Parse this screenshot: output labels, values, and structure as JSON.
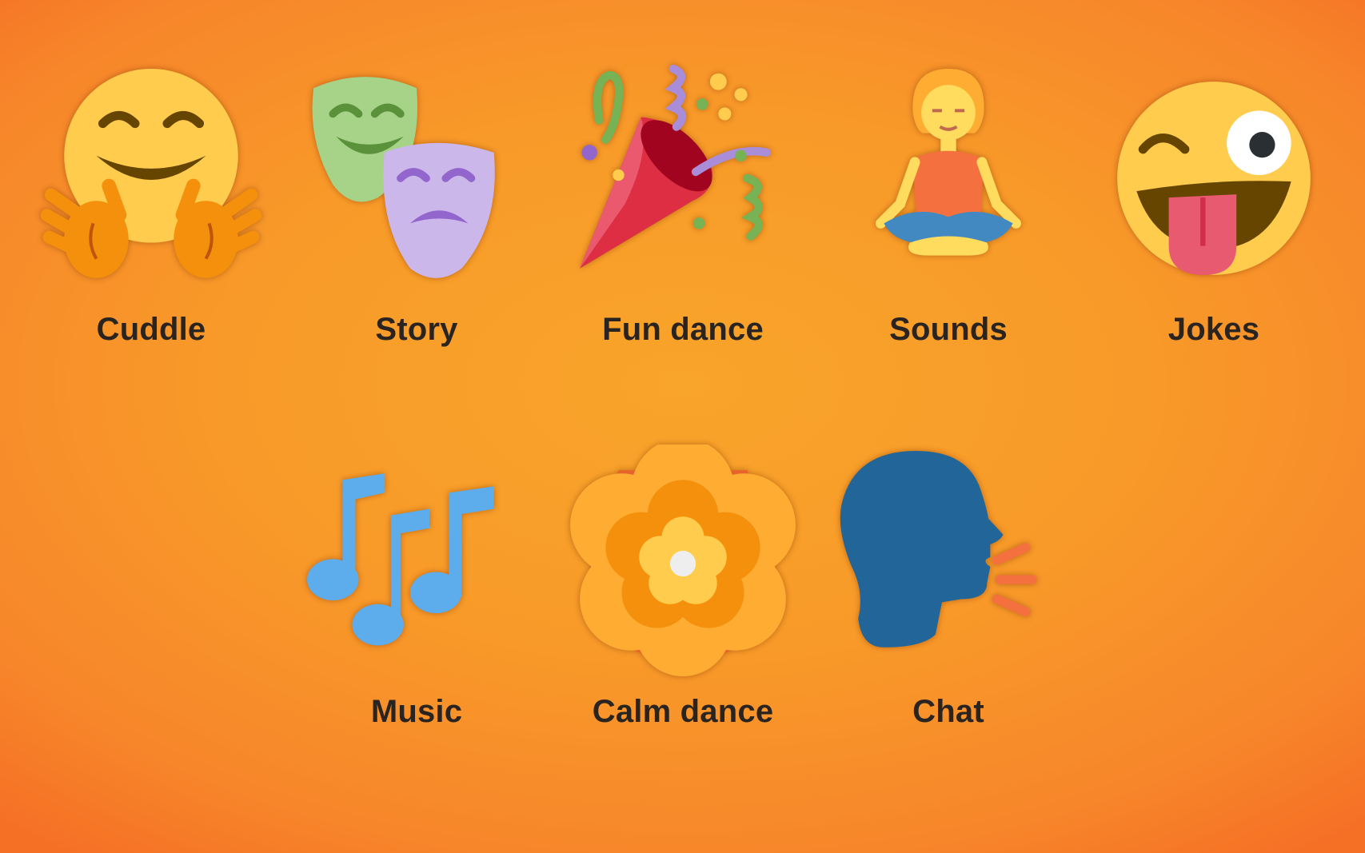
{
  "activities": [
    {
      "label": "Cuddle",
      "icon": "hugging-face-icon"
    },
    {
      "label": "Story",
      "icon": "performing-arts-masks-icon"
    },
    {
      "label": "Fun dance",
      "icon": "party-popper-icon"
    },
    {
      "label": "Sounds",
      "icon": "person-meditating-icon"
    },
    {
      "label": "Jokes",
      "icon": "winking-face-with-tongue-icon"
    },
    {
      "label": "Music",
      "icon": "musical-notes-icon"
    },
    {
      "label": "Calm dance",
      "icon": "rosette-flower-icon"
    },
    {
      "label": "Chat",
      "icon": "speaking-head-icon"
    }
  ],
  "colors": {
    "background": "#f89a29",
    "label_text": "#2a2421"
  }
}
